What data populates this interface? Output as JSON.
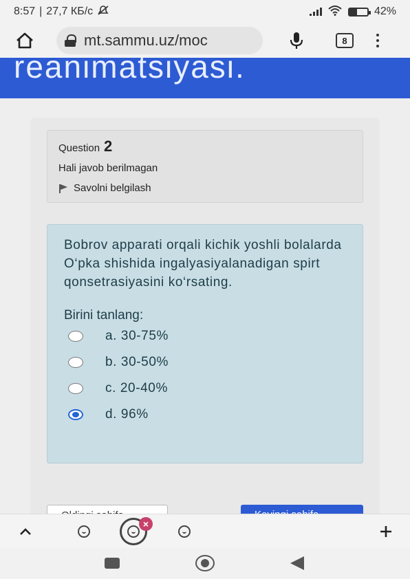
{
  "status_bar": {
    "time": "8:57",
    "speed": "27,7 КБ/с",
    "battery": "42%",
    "battery_level": 0.42
  },
  "browser": {
    "url": "mt.sammu.uz/moc",
    "tab_count": "8"
  },
  "page": {
    "header_title": "reanimatsiyasi."
  },
  "question_info": {
    "question_label": "Question",
    "question_number": "2",
    "state": "Hali javob berilmagan",
    "flag_label": "Savolni belgilash"
  },
  "question": {
    "text": "Bobrov apparati orqali kichik yoshli bolalarda O‘pka shishida ingalyasiyalanadigan spirt qonsetrasiyasini ko‘rsating.",
    "prompt": "Birini tanlang:",
    "options": [
      {
        "label": "a. 30-75%",
        "selected": false
      },
      {
        "label": "b. 30-50%",
        "selected": false
      },
      {
        "label": "c. 20-40%",
        "selected": false
      },
      {
        "label": "d. 96%",
        "selected": true
      }
    ]
  },
  "navigation": {
    "prev_label": "Oldingi sahifa",
    "next_label": "Keyingi sahifa"
  },
  "colors": {
    "header_blue": "#2d5bd4",
    "question_bg": "#c9dde5",
    "radio_selected": "#2364d6"
  }
}
